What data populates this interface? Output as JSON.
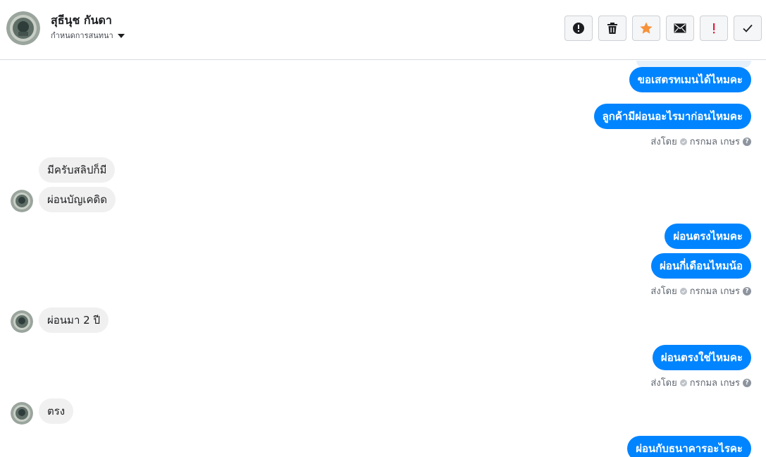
{
  "header": {
    "contact_name": "สุธีนุช กันดา",
    "status_label": "กำหนดการสนทนา",
    "toolbar": [
      {
        "name": "spam-button",
        "icon": "alert-circle-icon"
      },
      {
        "name": "delete-button",
        "icon": "trash-icon"
      },
      {
        "name": "star-button",
        "icon": "star-icon"
      },
      {
        "name": "mark-unread-button",
        "icon": "envelope-icon"
      },
      {
        "name": "important-button",
        "icon": "exclamation-icon"
      },
      {
        "name": "mark-done-button",
        "icon": "checkmark-icon"
      }
    ]
  },
  "colors": {
    "outgoing_bubble": "#0084ff",
    "incoming_bubble": "#f1f0f0",
    "star": "#f7923b",
    "important": "#e41e3f"
  },
  "messages": [
    {
      "dir": "out",
      "text": "ขอเสตรทเมนได้ไหมคะ"
    },
    {
      "dir": "out",
      "text": "ลูกค้ามีผ่อนอะไรมาก่อนไหมคะ"
    },
    {
      "dir": "in",
      "text": "มีครับสลิปก็มี"
    },
    {
      "dir": "in",
      "text": "ผ่อนบัญเคดิด"
    },
    {
      "dir": "out",
      "text": "ผ่อนตรงไหมคะ"
    },
    {
      "dir": "out",
      "text": "ผ่อนกี่เดือนไหมน้อ"
    },
    {
      "dir": "in",
      "text": "ผ่อนมา 2 ปี"
    },
    {
      "dir": "out",
      "text": "ผ่อนตรงใช่ไหมคะ"
    },
    {
      "dir": "in",
      "text": "ตรง"
    },
    {
      "dir": "out",
      "text": "ผ่อนกับธนาคารอะไรคะ"
    }
  ],
  "sent_by": {
    "label": "ส่งโดย",
    "agent": "กรกมล เกษร",
    "help": "?"
  }
}
